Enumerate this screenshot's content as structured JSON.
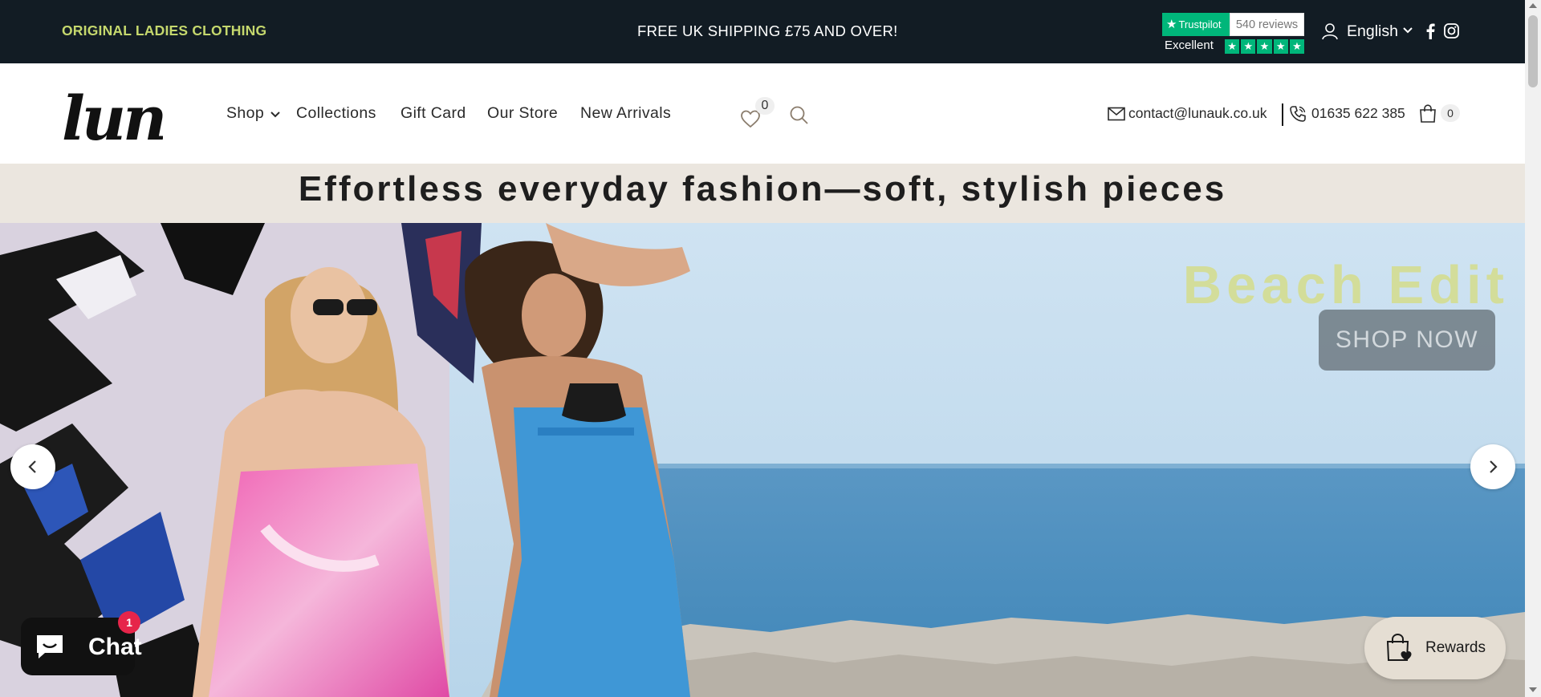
{
  "announcement": {
    "left_text": "ORIGINAL LADIES CLOTHING",
    "center_text": "FREE UK SHIPPING £75 AND OVER!",
    "trustpilot": {
      "brand": "Trustpilot",
      "reviews": "540 reviews",
      "rating_label": "Excellent",
      "stars": 5
    },
    "language": "English",
    "icons": [
      "user-icon",
      "chevron-down-icon",
      "facebook-icon",
      "instagram-icon"
    ]
  },
  "header": {
    "logo_text": "luna",
    "nav": [
      "Shop",
      "Collections",
      "Gift Card",
      "Our Store",
      "New Arrivals"
    ],
    "wishlist_count": "0",
    "email": "contact@lunauk.co.uk",
    "phone": "01635 622 385",
    "cart_count": "0"
  },
  "tagline": "Effortless everyday fashion—soft, stylish pieces",
  "hero": {
    "title": "Beach Edit",
    "cta": "SHOP NOW"
  },
  "chat": {
    "label": "Chat",
    "badge": "1"
  },
  "rewards": {
    "label": "Rewards"
  },
  "colors": {
    "topbar_bg": "#121c24",
    "accent_green": "#c5d86d",
    "tagline_band": "#ebe6df",
    "trustpilot_green": "#00b67a",
    "chat_badge": "#e6254a",
    "rewards_bg": "#e5ded3"
  }
}
